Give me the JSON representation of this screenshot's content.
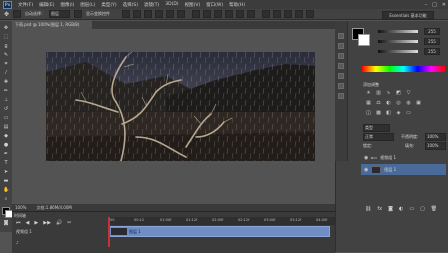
{
  "app": {
    "logo_text": "Ps"
  },
  "menu": [
    "文件(F)",
    "编辑(E)",
    "图像(I)",
    "图层(L)",
    "类型(Y)",
    "选择(S)",
    "滤镜(T)",
    "3D(D)",
    "视图(V)",
    "窗口(W)",
    "帮助(H)"
  ],
  "window_controls": {
    "minimize": "–",
    "maximize": "□",
    "close": "✕"
  },
  "options": {
    "auto_select_label": "自动选择：",
    "auto_select_value": "图层",
    "transform_label": "显示变换控件",
    "workspace": "Essentials 基本功能"
  },
  "document": {
    "tab_label": "下雨.psd @ 100%(图层 1, RGB/8)",
    "zoom": "100%",
    "doc_info": "文档:1.86M/4.00M"
  },
  "timeline": {
    "title": "时间轴",
    "ticks": [
      "00",
      "00:12",
      "01:00f",
      "01:12f",
      "02:00f",
      "02:12f",
      "03:00f",
      "03:12f",
      "04:00f"
    ],
    "layer_label": "视频组 1",
    "clip_label": "图层 1",
    "audio_label": "♪",
    "controls": [
      "⏮",
      "◀",
      "▶",
      "▶▶",
      "🔊",
      "✂"
    ]
  },
  "color_panel": {
    "r": "255",
    "g": "255",
    "b": "255"
  },
  "adjustments": {
    "title": "添加调整"
  },
  "layers": {
    "kind_label": "类型",
    "mode_label": "正常",
    "opacity_label": "不透明度:",
    "opacity_value": "100%",
    "fill_label": "填充:",
    "fill_value": "100%",
    "lock_label": "锁定:",
    "rows": [
      {
        "name": "视频组 1",
        "selected": false
      },
      {
        "name": "图层 1",
        "selected": true
      }
    ]
  },
  "colors": {
    "accent": "#6f8ec5",
    "playhead": "#c83232",
    "selected_layer": "#4a6a9a"
  }
}
